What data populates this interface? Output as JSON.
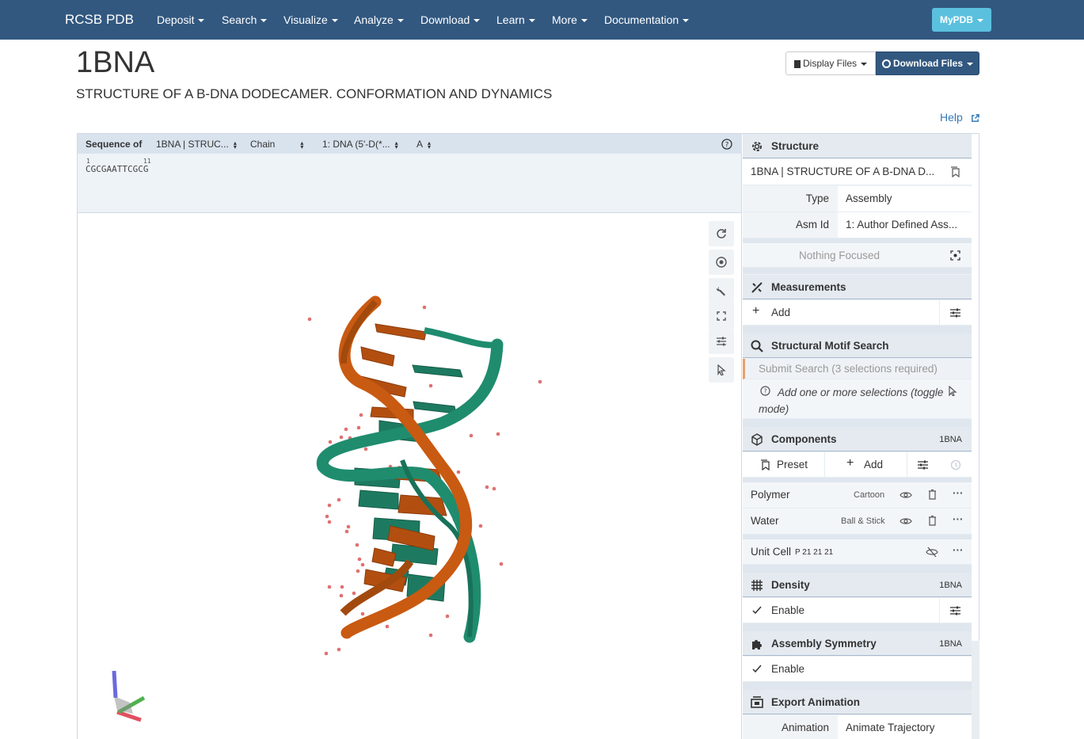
{
  "navbar": {
    "brand": "RCSB PDB",
    "items": [
      "Deposit",
      "Search",
      "Visualize",
      "Analyze",
      "Download",
      "Learn",
      "More",
      "Documentation"
    ],
    "mypdb": "MyPDB"
  },
  "entry": {
    "id": "1BNA",
    "title": "STRUCTURE OF A B-DNA DODECAMER. CONFORMATION AND DYNAMICS"
  },
  "actions": {
    "display_files": "Display Files",
    "download_files": "Download Files",
    "help": "Help"
  },
  "sequence": {
    "label": "Sequence of",
    "structure_select": "1BNA | STRUC...",
    "mode_select": "Chain",
    "entity_select": "1: DNA (5'-D(*...",
    "chain_select": "A",
    "residues": "CGCGAATTCGCG",
    "num_1": "1",
    "num_11": "11"
  },
  "structure_panel": {
    "title": "Structure",
    "name": "1BNA | STRUCTURE OF A B-DNA D...",
    "type_label": "Type",
    "type_value": "Assembly",
    "asm_label": "Asm Id",
    "asm_value": "1: Author Defined Ass...",
    "focus": "Nothing Focused"
  },
  "measurements": {
    "title": "Measurements",
    "add": "Add"
  },
  "motif": {
    "title": "Structural Motif Search",
    "submit": "Submit Search (3 selections required)",
    "hint": "Add one or more selections (toggle mode)"
  },
  "components": {
    "title": "Components",
    "tag": "1BNA",
    "preset": "Preset",
    "add": "Add",
    "rows": [
      {
        "name": "Polymer",
        "repr": "Cartoon"
      },
      {
        "name": "Water",
        "repr": "Ball & Stick"
      }
    ],
    "unit_cell": "Unit Cell",
    "unit_cell_group": "P 21 21 21"
  },
  "density": {
    "title": "Density",
    "tag": "1BNA",
    "enable": "Enable"
  },
  "symmetry": {
    "title": "Assembly Symmetry",
    "tag": "1BNA",
    "enable": "Enable"
  },
  "export": {
    "title": "Export Animation",
    "anim_label": "Animation",
    "anim_value": "Animate Trajectory"
  },
  "colors": {
    "navbar": "#325880",
    "mypdb": "#5bc0de",
    "strand_orange": "#c95a12",
    "strand_green": "#1f8c6e",
    "water": "#e07070"
  }
}
